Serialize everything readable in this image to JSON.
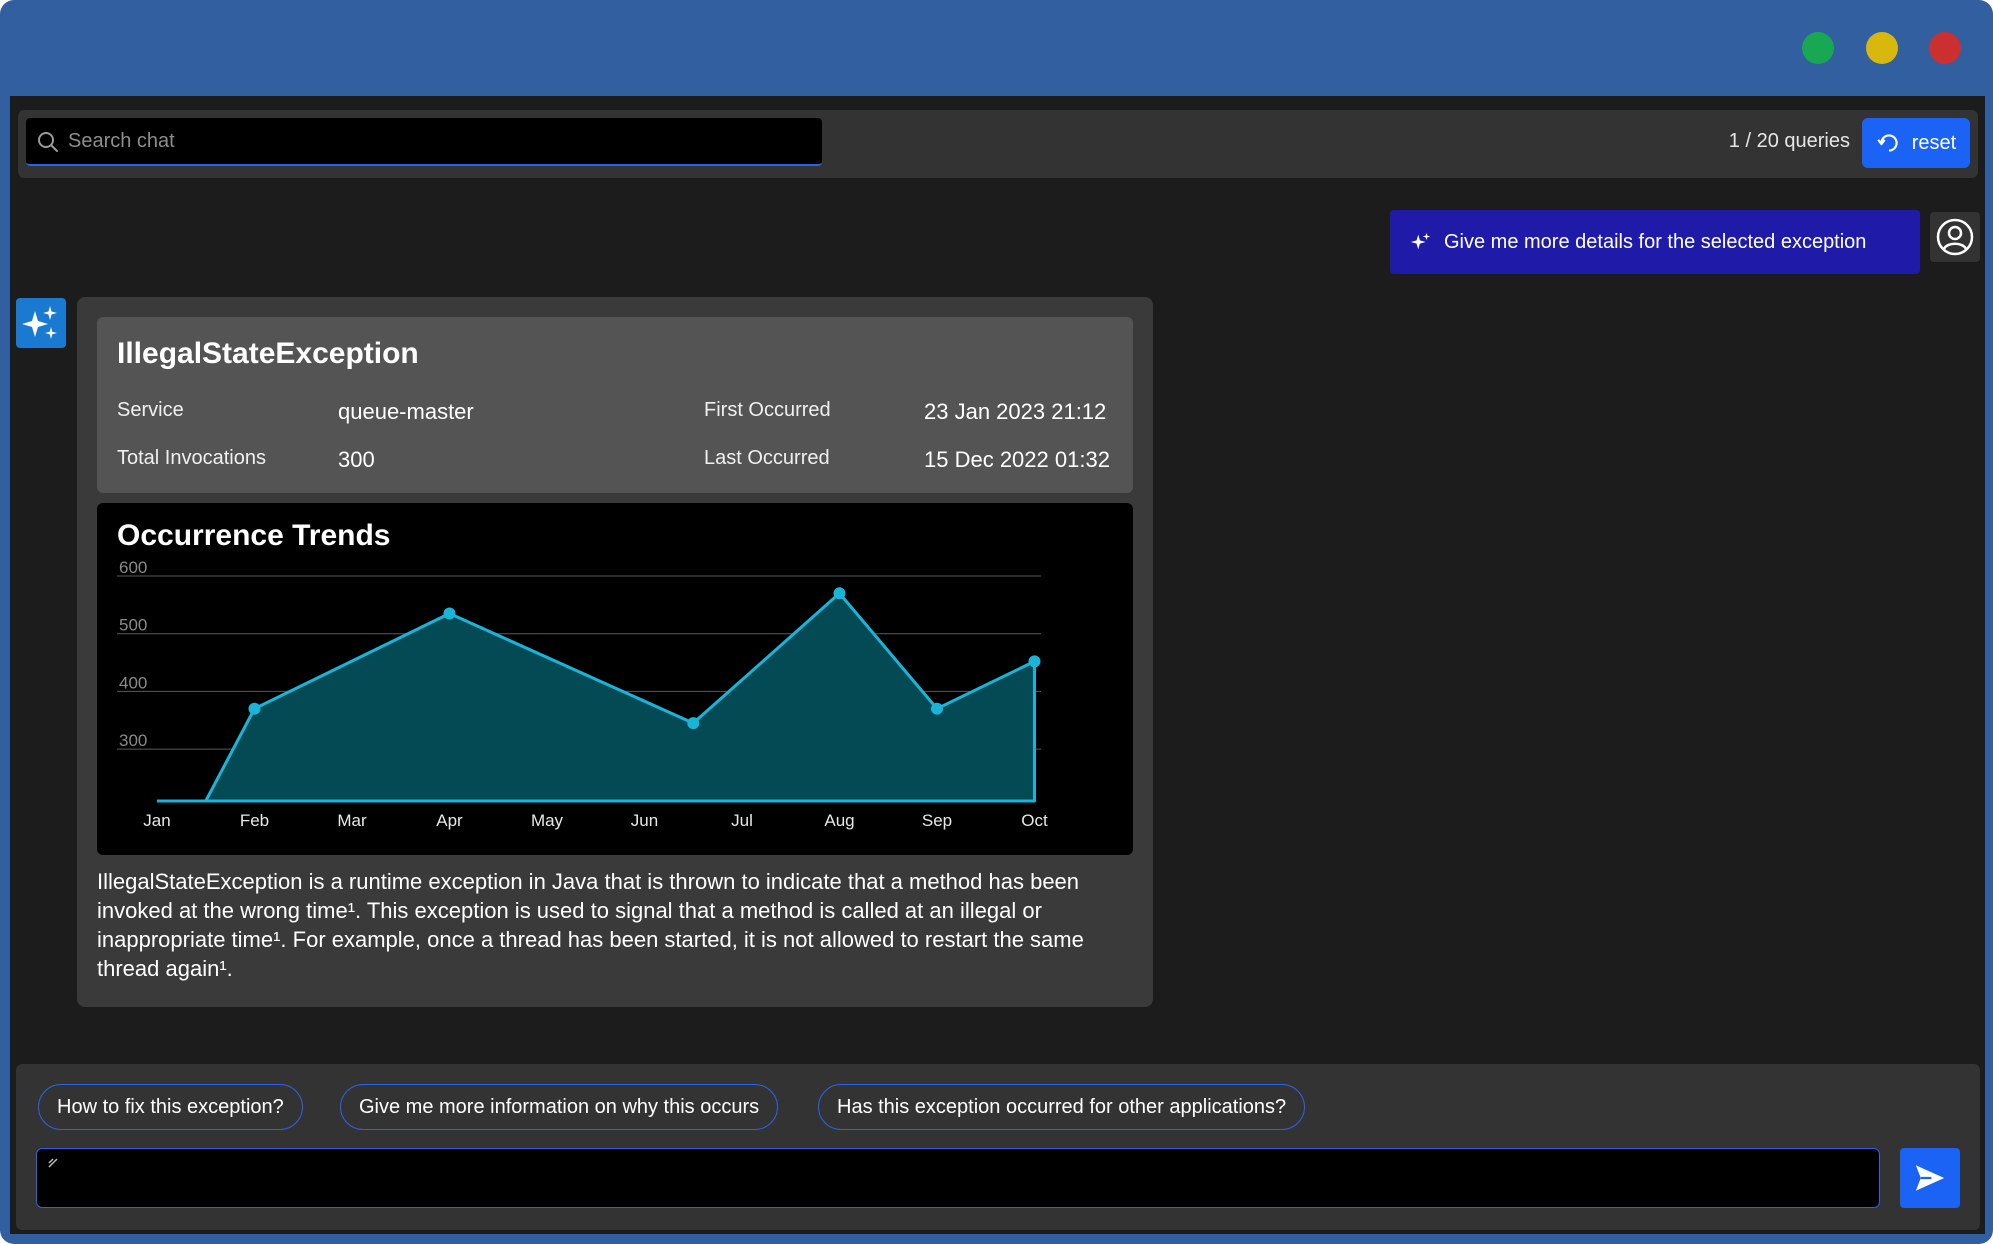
{
  "search": {
    "placeholder": "Search chat"
  },
  "queries": {
    "label": "1 / 20 queries"
  },
  "reset": {
    "label": "reset"
  },
  "user_message": {
    "text": "Give me more details for the selected exception"
  },
  "exception": {
    "title": "IllegalStateException",
    "service_label": "Service",
    "service_value": "queue-master",
    "invocations_label": "Total Invocations",
    "invocations_value": "300",
    "first_label": "First Occurred",
    "first_value": "23 Jan 2023 21:12",
    "last_label": "Last Occurred",
    "last_value": "15 Dec 2022 01:32"
  },
  "chart_data": {
    "type": "area",
    "title": "Occurrence Trends",
    "categories": [
      "Jan",
      "Feb",
      "Mar",
      "Apr",
      "May",
      "Jun",
      "Jul",
      "Aug",
      "Sep",
      "Oct"
    ],
    "series": [
      {
        "x": [
          "Jan",
          "Jan-Feb",
          "Feb",
          "Apr",
          "Jun-Jul",
          "Aug",
          "Sep",
          "Oct"
        ],
        "y": [
          210,
          210,
          370,
          535,
          345,
          570,
          370,
          452
        ]
      }
    ],
    "yticks": [
      300,
      400,
      500,
      600
    ],
    "ylim": [
      210,
      600
    ],
    "grid": true,
    "color": "#19b5d8",
    "fill": "#034a55"
  },
  "description": {
    "text": "IllegalStateException is a runtime exception in Java that is thrown to indicate that a method has been invoked at the wrong time¹. This exception is used to signal that a method is called at an illegal or inappropriate time¹. For example, once a thread has been started, it is not allowed to restart the same thread again¹."
  },
  "suggestions": [
    "How to fix this exception?",
    "Give me more information on why this occurs",
    "Has this exception occurred for other applications?"
  ],
  "chat_input": {
    "value": ""
  },
  "colors": {
    "accent": "#1a63f5",
    "user_bubble": "#1f1ba8",
    "window_frame": "#325f9f"
  }
}
